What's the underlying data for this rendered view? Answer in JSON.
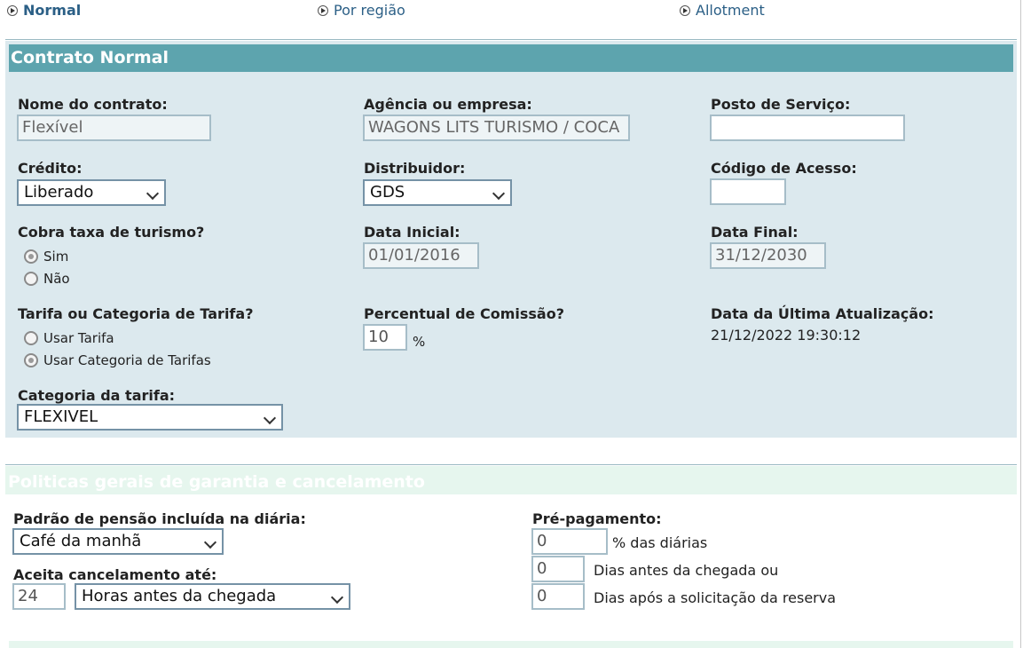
{
  "tabs": [
    {
      "label": "Normal",
      "active": true
    },
    {
      "label": "Por região",
      "active": false
    },
    {
      "label": "Allotment",
      "active": false
    }
  ],
  "contract": {
    "title": "Contrato Normal",
    "nome_label": "Nome do contrato:",
    "nome_value": "Flexível",
    "agencia_label": "Agência ou empresa:",
    "agencia_value": "WAGONS LITS TURISMO / COCA",
    "posto_label": "Posto de Serviço:",
    "posto_value": "",
    "credito_label": "Crédito:",
    "credito_value": "Liberado",
    "distribuidor_label": "Distribuidor:",
    "distribuidor_value": "GDS",
    "codigo_label": "Código de Acesso:",
    "codigo_value": "",
    "taxa_label": "Cobra taxa de turismo?",
    "taxa_sim": "Sim",
    "taxa_nao": "Não",
    "data_inicial_label": "Data Inicial:",
    "data_inicial_value": "01/01/2016",
    "data_final_label": "Data Final:",
    "data_final_value": "31/12/2030",
    "tarifa_label": "Tarifa ou Categoria de Tarifa?",
    "tarifa_opt1": "Usar Tarifa",
    "tarifa_opt2": "Usar Categoria de Tarifas",
    "comissao_label": "Percentual de Comissão?",
    "comissao_value": "10",
    "comissao_unit": "%",
    "atualizacao_label": "Data da Última Atualização:",
    "atualizacao_value": "21/12/2022 19:30:12",
    "categoria_label": "Categoria da tarifa:",
    "categoria_value": "FLEXIVEL"
  },
  "policies": {
    "title": "Politicas gerais de garantia e cancelamento",
    "pensao_label": "Padrão de pensão incluída na diária:",
    "pensao_value": "Café da manhã",
    "cancel_label": "Aceita cancelamento até:",
    "cancel_value": "24",
    "cancel_unit": "Horas antes da chegada",
    "prepag_label": "Pré-pagamento:",
    "prepag_pct_value": "0",
    "prepag_pct_text": "% das diárias",
    "prepag_dias_antes_value": "0",
    "prepag_dias_antes_text": "Dias antes da chegada ou",
    "prepag_dias_apos_value": "0",
    "prepag_dias_apos_text": "Dias após a solicitação da reserva"
  },
  "colors": {
    "header": "#5da4ae",
    "panel": "#dce9ee",
    "tab_text": "#2b5f86"
  }
}
